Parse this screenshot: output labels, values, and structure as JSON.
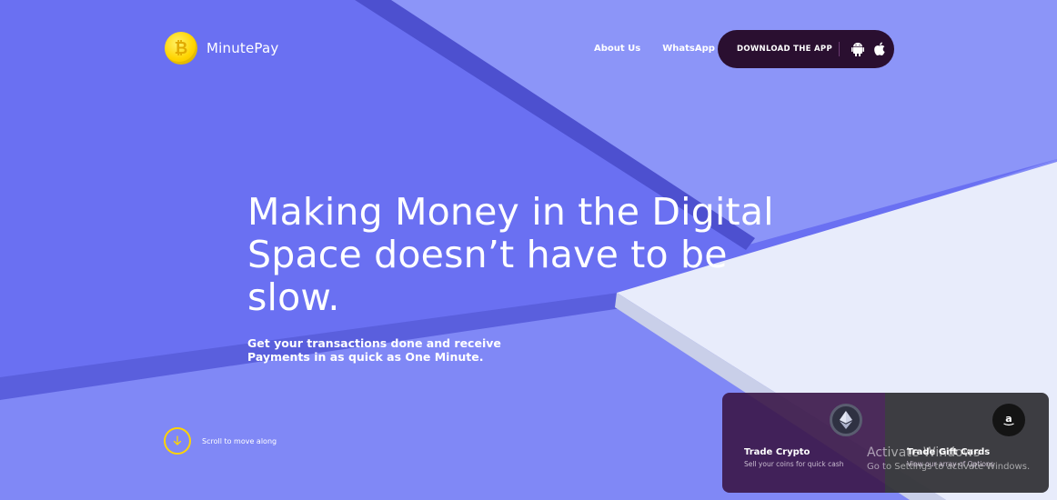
{
  "brand": {
    "name": "MinutePay"
  },
  "nav": {
    "about": "About Us",
    "whatsapp": "WhatsApp"
  },
  "download": {
    "label": "DOWNLOAD THE APP",
    "icons": [
      "android-icon",
      "apple-icon"
    ]
  },
  "hero": {
    "title": "Making Money in the Digital Space doesn’t have to be slow.",
    "subtitle": "Get your transactions done and receive Payments in as quick as One Minute."
  },
  "scroll": {
    "label": "Scroll to move along"
  },
  "cards": [
    {
      "title": "Trade Crypto",
      "subtitle": "Sell your coins for quick cash",
      "icon": "ethereum-icon"
    },
    {
      "title": "Trade Gift Cards",
      "subtitle": "View our array of Options",
      "icon": "amazon-icon"
    }
  ],
  "watermark": {
    "line1": "Activate Windows",
    "line2": "Go to Settings to activate Windows."
  },
  "colors": {
    "accent": "#ffd400",
    "background": "#6b72f3",
    "button": "#2a0f30",
    "panel_light": "#e8ecfb"
  }
}
